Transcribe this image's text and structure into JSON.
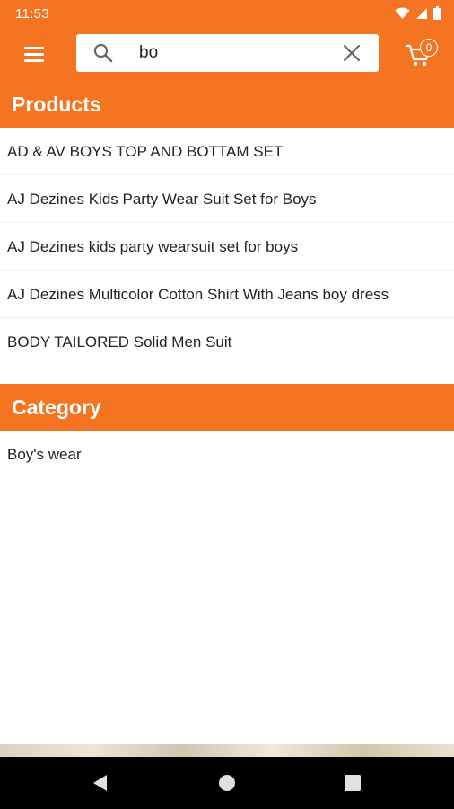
{
  "status_bar": {
    "time": "11:53"
  },
  "app_bar": {
    "menu_icon": "hamburger-menu-icon",
    "search": {
      "value": "bo",
      "icon": "search-icon",
      "clear_icon": "close-icon"
    },
    "cart": {
      "icon": "cart-icon",
      "count": "0"
    }
  },
  "products": {
    "title": "Products",
    "items": [
      {
        "label": "AD & AV BOYS TOP AND BOTTAM SET"
      },
      {
        "label": "AJ Dezines Kids Party Wear Suit Set for Boys"
      },
      {
        "label": "AJ Dezines kids party wearsuit set for boys"
      },
      {
        "label": "AJ Dezines Multicolor Cotton Shirt With Jeans boy dress"
      },
      {
        "label": "BODY TAILORED Solid Men Suit"
      }
    ]
  },
  "category": {
    "title": "Category",
    "items": [
      {
        "label": "Boy's wear"
      }
    ]
  },
  "nav_bar": {
    "back_icon": "back-icon",
    "home_icon": "home-icon",
    "recents_icon": "recents-icon"
  },
  "colors": {
    "accent": "#f47421",
    "nav_bar": "#000000",
    "text": "#222222"
  }
}
